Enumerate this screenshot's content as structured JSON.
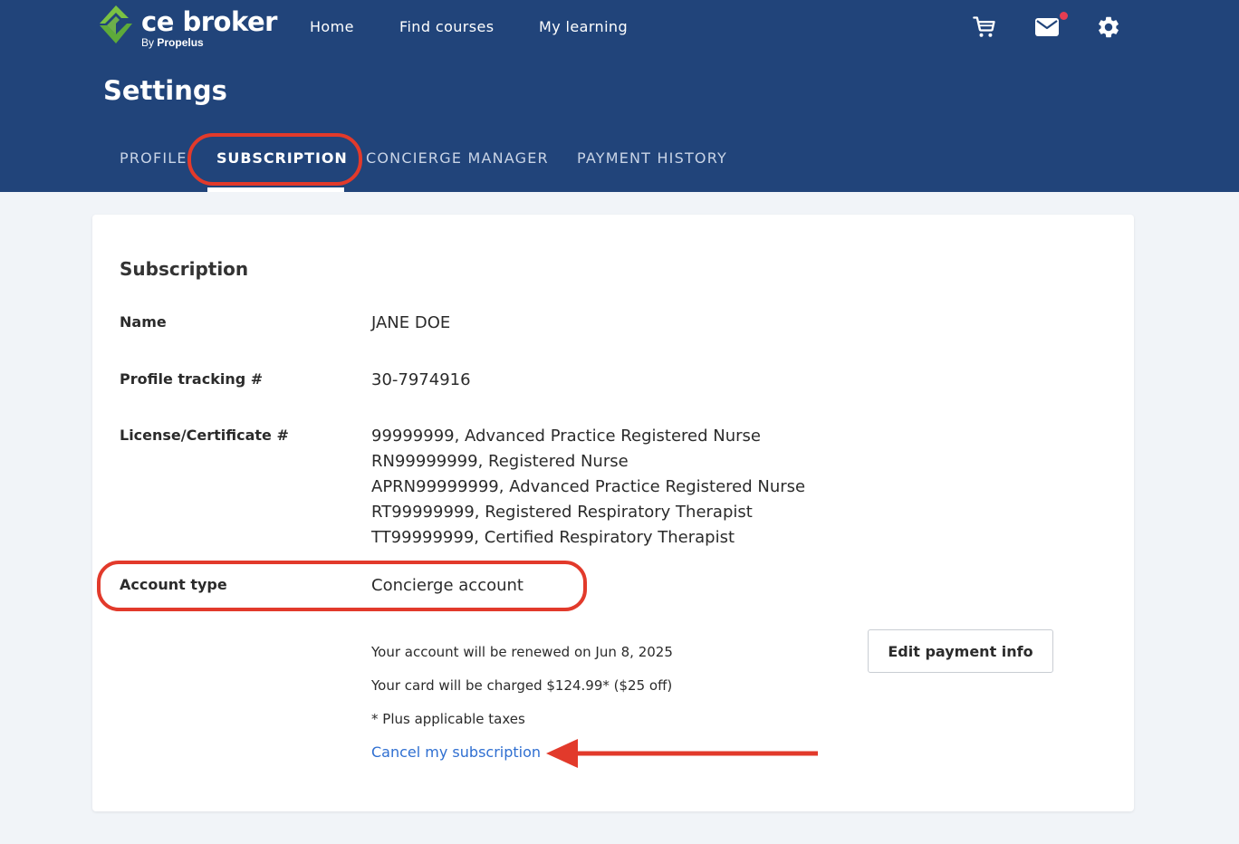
{
  "header": {
    "brand": {
      "name": "ce broker",
      "sub_prefix": "By",
      "sub_name": "Propelus"
    },
    "nav": [
      {
        "label": "Home"
      },
      {
        "label": "Find courses"
      },
      {
        "label": "My learning"
      }
    ],
    "icons": [
      "cart-icon",
      "mail-icon",
      "settings-gear-icon"
    ],
    "notification_dot": true,
    "page_title": "Settings",
    "tabs": [
      {
        "label": "PROFILE",
        "active": false
      },
      {
        "label": "SUBSCRIPTION",
        "active": true
      },
      {
        "label": "CONCIERGE MANAGER",
        "active": false
      },
      {
        "label": "PAYMENT HISTORY",
        "active": false
      }
    ]
  },
  "subscription": {
    "title": "Subscription",
    "fields": {
      "name": {
        "label": "Name",
        "value": "JANE DOE"
      },
      "tracking": {
        "label": "Profile tracking #",
        "value": "30-7974916"
      },
      "license": {
        "label": "License/Certificate #",
        "values": [
          "99999999, Advanced Practice Registered Nurse",
          "RN99999999, Registered Nurse",
          "APRN99999999, Advanced Practice Registered Nurse",
          "RT99999999, Registered Respiratory Therapist",
          "TT99999999, Certified Respiratory Therapist"
        ]
      },
      "account_type": {
        "label": "Account type",
        "value": "Concierge account"
      }
    },
    "renewal_text": "Your account will be renewed on Jun 8, 2025",
    "charge_text": "Your card will be charged $124.99* ($25 off)",
    "tax_note": "* Plus applicable taxes",
    "cancel_link": "Cancel my subscription",
    "edit_payment_button": "Edit payment info"
  },
  "colors": {
    "header_bg": "#21447a",
    "page_bg": "#f1f4f8",
    "link": "#2f6fd1",
    "annotation": "#e23a2b",
    "logo_green": "#7ac143",
    "notification": "#e53d52"
  }
}
